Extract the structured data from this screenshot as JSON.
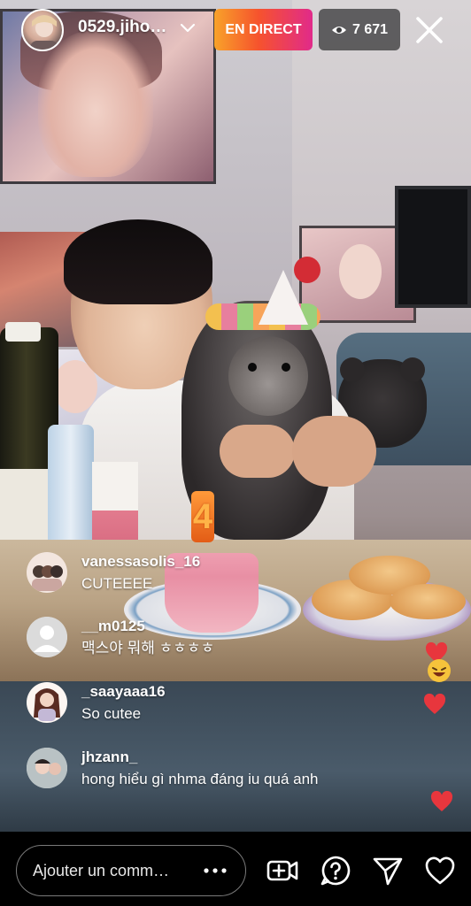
{
  "header": {
    "username": "0529.jiho…",
    "live_label": "EN DIRECT",
    "viewer_count": "7 671"
  },
  "comments": [
    {
      "user": "vanessasolis_16",
      "text": "CUTEEEE"
    },
    {
      "user": "__m0125",
      "text": "맥스야 뭐해 ㅎㅎㅎㅎ"
    },
    {
      "user": "_saayaaa16",
      "text": "So cutee"
    },
    {
      "user": "jhzann_",
      "text": "hong hiểu gì nhma đáng iu quá anh"
    }
  ],
  "scene": {
    "candle_text": "4"
  },
  "bottom_bar": {
    "comment_placeholder": "Ajouter un comm…"
  },
  "colors": {
    "live_gradient_start": "#f8a22a",
    "live_gradient_end": "#e12a8a",
    "heart": "#e8363d"
  },
  "icons": [
    "chevron-down-icon",
    "eye-icon",
    "close-icon",
    "more-dots-icon",
    "add-guest-icon",
    "question-icon",
    "send-icon",
    "heart-icon"
  ]
}
